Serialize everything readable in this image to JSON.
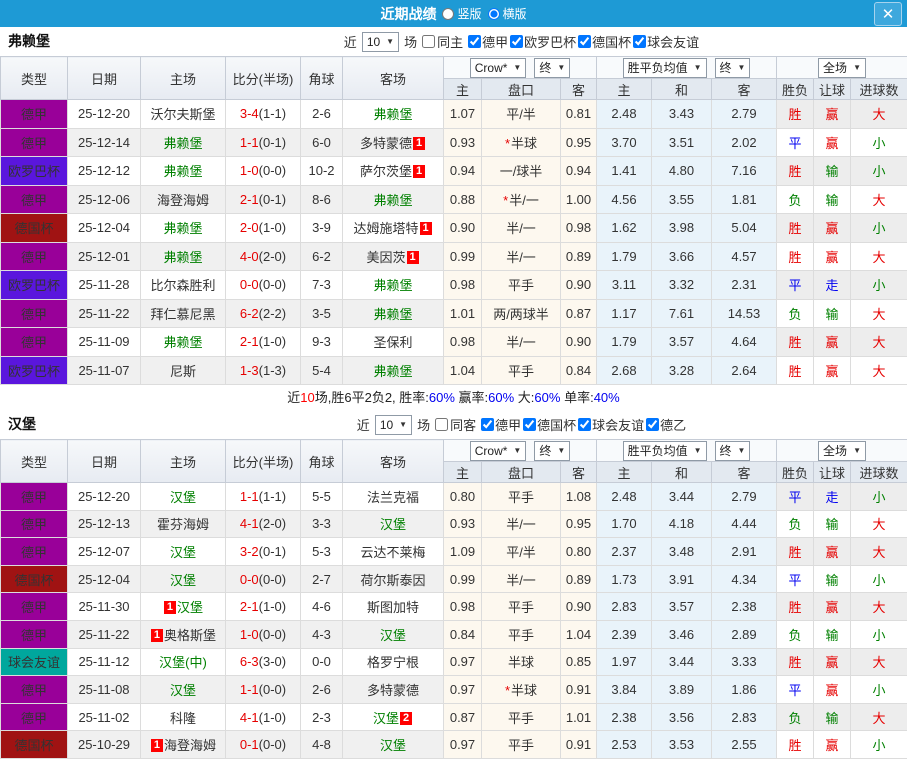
{
  "colors": {
    "titlebar_bg": "#1e9ad5",
    "league": {
      "德甲": "#990099",
      "欧罗巴杯": "#5a16dd",
      "德国杯": "#a01313",
      "球会友谊": "#00a79d"
    },
    "result": {
      "胜": "#e60000",
      "平": "#0000f0",
      "负": "#008000",
      "赢": "#e60000",
      "走": "#0000f0",
      "输": "#008000",
      "大": "#e60000",
      "小": "#008000"
    },
    "focus_team": "#008000",
    "score": "#e60000"
  },
  "titlebar": {
    "title": "近期战绩",
    "vertical_label": "竖版",
    "horizontal_label": "横版",
    "selected_layout": "横版",
    "close_icon": "✕"
  },
  "table_header": {
    "type": "类型",
    "date": "日期",
    "home": "主场",
    "score": "比分(半场)",
    "corners": "角球",
    "away": "客场",
    "crow_select": "Crow*",
    "final_select": "终",
    "avg_select": "胜平负均值",
    "scope_select": "全场",
    "sub": {
      "home": "主",
      "handicap": "盘口",
      "away": "客",
      "avg_home": "主",
      "avg_draw": "和",
      "avg_away": "客",
      "result": "胜负",
      "let": "让球",
      "goals": "进球数"
    }
  },
  "sections": [
    {
      "team": "弗赖堡",
      "filter": {
        "near": "近",
        "count": "10",
        "unit": "场",
        "same": "同主",
        "same_checked": false,
        "leagues": [
          "德甲",
          "欧罗巴杯",
          "德国杯",
          "球会友谊"
        ]
      },
      "rows": [
        {
          "type": "德甲",
          "date": "25-12-20",
          "home": {
            "name": "沃尔夫斯堡",
            "focus": false
          },
          "ft": "3-4",
          "ht": "(1-1)",
          "corners": "2-6",
          "away": {
            "name": "弗赖堡",
            "focus": true
          },
          "crow_home": "1.07",
          "handicap": "平/半",
          "handicap_star": false,
          "crow_away": "0.81",
          "avg_home": "2.48",
          "avg_draw": "3.43",
          "avg_away": "2.79",
          "result": "胜",
          "let_result": "赢",
          "goal_result": "大"
        },
        {
          "type": "德甲",
          "date": "25-12-14",
          "home": {
            "name": "弗赖堡",
            "focus": true
          },
          "ft": "1-1",
          "ht": "(0-1)",
          "corners": "6-0",
          "away": {
            "name": "多特蒙德",
            "focus": false,
            "badge": "1",
            "badge_pos": "after"
          },
          "crow_home": "0.93",
          "handicap": "半球",
          "handicap_star": true,
          "crow_away": "0.95",
          "avg_home": "3.70",
          "avg_draw": "3.51",
          "avg_away": "2.02",
          "result": "平",
          "let_result": "赢",
          "goal_result": "小"
        },
        {
          "type": "欧罗巴杯",
          "date": "25-12-12",
          "home": {
            "name": "弗赖堡",
            "focus": true
          },
          "ft": "1-0",
          "ht": "(0-0)",
          "corners": "10-2",
          "away": {
            "name": "萨尔茨堡",
            "focus": false,
            "badge": "1",
            "badge_pos": "after"
          },
          "crow_home": "0.94",
          "handicap": "一/球半",
          "handicap_star": false,
          "crow_away": "0.94",
          "avg_home": "1.41",
          "avg_draw": "4.80",
          "avg_away": "7.16",
          "result": "胜",
          "let_result": "输",
          "goal_result": "小"
        },
        {
          "type": "德甲",
          "date": "25-12-06",
          "home": {
            "name": "海登海姆",
            "focus": false
          },
          "ft": "2-1",
          "ht": "(0-1)",
          "corners": "8-6",
          "away": {
            "name": "弗赖堡",
            "focus": true
          },
          "crow_home": "0.88",
          "handicap": "半/一",
          "handicap_star": true,
          "crow_away": "1.00",
          "avg_home": "4.56",
          "avg_draw": "3.55",
          "avg_away": "1.81",
          "result": "负",
          "let_result": "输",
          "goal_result": "大"
        },
        {
          "type": "德国杯",
          "date": "25-12-04",
          "home": {
            "name": "弗赖堡",
            "focus": true
          },
          "ft": "2-0",
          "ht": "(1-0)",
          "corners": "3-9",
          "away": {
            "name": "达姆施塔特",
            "focus": false,
            "badge": "1",
            "badge_pos": "after"
          },
          "crow_home": "0.90",
          "handicap": "半/一",
          "handicap_star": false,
          "crow_away": "0.98",
          "avg_home": "1.62",
          "avg_draw": "3.98",
          "avg_away": "5.04",
          "result": "胜",
          "let_result": "赢",
          "goal_result": "小"
        },
        {
          "type": "德甲",
          "date": "25-12-01",
          "home": {
            "name": "弗赖堡",
            "focus": true
          },
          "ft": "4-0",
          "ht": "(2-0)",
          "corners": "6-2",
          "away": {
            "name": "美因茨",
            "focus": false,
            "badge": "1",
            "badge_pos": "after"
          },
          "crow_home": "0.99",
          "handicap": "半/一",
          "handicap_star": false,
          "crow_away": "0.89",
          "avg_home": "1.79",
          "avg_draw": "3.66",
          "avg_away": "4.57",
          "result": "胜",
          "let_result": "赢",
          "goal_result": "大"
        },
        {
          "type": "欧罗巴杯",
          "date": "25-11-28",
          "home": {
            "name": "比尔森胜利",
            "focus": false
          },
          "ft": "0-0",
          "ht": "(0-0)",
          "corners": "7-3",
          "away": {
            "name": "弗赖堡",
            "focus": true
          },
          "crow_home": "0.98",
          "handicap": "平手",
          "handicap_star": false,
          "crow_away": "0.90",
          "avg_home": "3.11",
          "avg_draw": "3.32",
          "avg_away": "2.31",
          "result": "平",
          "let_result": "走",
          "goal_result": "小"
        },
        {
          "type": "德甲",
          "date": "25-11-22",
          "home": {
            "name": "拜仁慕尼黑",
            "focus": false
          },
          "ft": "6-2",
          "ht": "(2-2)",
          "corners": "3-5",
          "away": {
            "name": "弗赖堡",
            "focus": true
          },
          "crow_home": "1.01",
          "handicap": "两/两球半",
          "handicap_star": false,
          "crow_away": "0.87",
          "avg_home": "1.17",
          "avg_draw": "7.61",
          "avg_away": "14.53",
          "result": "负",
          "let_result": "输",
          "goal_result": "大"
        },
        {
          "type": "德甲",
          "date": "25-11-09",
          "home": {
            "name": "弗赖堡",
            "focus": true
          },
          "ft": "2-1",
          "ht": "(1-0)",
          "corners": "9-3",
          "away": {
            "name": "圣保利",
            "focus": false
          },
          "crow_home": "0.98",
          "handicap": "半/一",
          "handicap_star": false,
          "crow_away": "0.90",
          "avg_home": "1.79",
          "avg_draw": "3.57",
          "avg_away": "4.64",
          "result": "胜",
          "let_result": "赢",
          "goal_result": "大"
        },
        {
          "type": "欧罗巴杯",
          "date": "25-11-07",
          "home": {
            "name": "尼斯",
            "focus": false
          },
          "ft": "1-3",
          "ht": "(1-3)",
          "corners": "5-4",
          "away": {
            "name": "弗赖堡",
            "focus": true
          },
          "crow_home": "1.04",
          "handicap": "平手",
          "handicap_star": false,
          "crow_away": "0.84",
          "avg_home": "2.68",
          "avg_draw": "3.28",
          "avg_away": "2.64",
          "result": "胜",
          "let_result": "赢",
          "goal_result": "大"
        }
      ],
      "summary": [
        {
          "t": "近",
          "c": "dark"
        },
        {
          "t": "10",
          "c": "red"
        },
        {
          "t": "场,胜6平2负2, 胜率:",
          "c": "dark"
        },
        {
          "t": "60%",
          "c": "blue"
        },
        {
          "t": " 赢率:",
          "c": "dark"
        },
        {
          "t": "60%",
          "c": "blue"
        },
        {
          "t": " 大:",
          "c": "dark"
        },
        {
          "t": "60%",
          "c": "blue"
        },
        {
          "t": " 单率:",
          "c": "dark"
        },
        {
          "t": "40%",
          "c": "blue"
        }
      ]
    },
    {
      "team": "汉堡",
      "filter": {
        "near": "近",
        "count": "10",
        "unit": "场",
        "same": "同客",
        "same_checked": false,
        "leagues": [
          "德甲",
          "德国杯",
          "球会友谊",
          "德乙"
        ]
      },
      "rows": [
        {
          "type": "德甲",
          "date": "25-12-20",
          "home": {
            "name": "汉堡",
            "focus": true
          },
          "ft": "1-1",
          "ht": "(1-1)",
          "corners": "5-5",
          "away": {
            "name": "法兰克福",
            "focus": false
          },
          "crow_home": "0.80",
          "handicap": "平手",
          "handicap_star": false,
          "crow_away": "1.08",
          "avg_home": "2.48",
          "avg_draw": "3.44",
          "avg_away": "2.79",
          "result": "平",
          "let_result": "走",
          "goal_result": "小"
        },
        {
          "type": "德甲",
          "date": "25-12-13",
          "home": {
            "name": "霍芬海姆",
            "focus": false
          },
          "ft": "4-1",
          "ht": "(2-0)",
          "corners": "3-3",
          "away": {
            "name": "汉堡",
            "focus": true
          },
          "crow_home": "0.93",
          "handicap": "半/一",
          "handicap_star": false,
          "crow_away": "0.95",
          "avg_home": "1.70",
          "avg_draw": "4.18",
          "avg_away": "4.44",
          "result": "负",
          "let_result": "输",
          "goal_result": "大"
        },
        {
          "type": "德甲",
          "date": "25-12-07",
          "home": {
            "name": "汉堡",
            "focus": true
          },
          "ft": "3-2",
          "ht": "(0-1)",
          "corners": "5-3",
          "away": {
            "name": "云达不莱梅",
            "focus": false
          },
          "crow_home": "1.09",
          "handicap": "平/半",
          "handicap_star": false,
          "crow_away": "0.80",
          "avg_home": "2.37",
          "avg_draw": "3.48",
          "avg_away": "2.91",
          "result": "胜",
          "let_result": "赢",
          "goal_result": "大"
        },
        {
          "type": "德国杯",
          "date": "25-12-04",
          "home": {
            "name": "汉堡",
            "focus": true
          },
          "ft": "0-0",
          "ht": "(0-0)",
          "corners": "2-7",
          "away": {
            "name": "荷尔斯泰因",
            "focus": false
          },
          "crow_home": "0.99",
          "handicap": "半/一",
          "handicap_star": false,
          "crow_away": "0.89",
          "avg_home": "1.73",
          "avg_draw": "3.91",
          "avg_away": "4.34",
          "result": "平",
          "let_result": "输",
          "goal_result": "小"
        },
        {
          "type": "德甲",
          "date": "25-11-30",
          "home": {
            "name": "汉堡",
            "focus": true,
            "badge": "1",
            "badge_pos": "before"
          },
          "ft": "2-1",
          "ht": "(1-0)",
          "corners": "4-6",
          "away": {
            "name": "斯图加特",
            "focus": false
          },
          "crow_home": "0.98",
          "handicap": "平手",
          "handicap_star": false,
          "crow_away": "0.90",
          "avg_home": "2.83",
          "avg_draw": "3.57",
          "avg_away": "2.38",
          "result": "胜",
          "let_result": "赢",
          "goal_result": "大"
        },
        {
          "type": "德甲",
          "date": "25-11-22",
          "home": {
            "name": "奥格斯堡",
            "focus": false,
            "badge": "1",
            "badge_pos": "before"
          },
          "ft": "1-0",
          "ht": "(0-0)",
          "corners": "4-3",
          "away": {
            "name": "汉堡",
            "focus": true
          },
          "crow_home": "0.84",
          "handicap": "平手",
          "handicap_star": false,
          "crow_away": "1.04",
          "avg_home": "2.39",
          "avg_draw": "3.46",
          "avg_away": "2.89",
          "result": "负",
          "let_result": "输",
          "goal_result": "小"
        },
        {
          "type": "球会友谊",
          "date": "25-11-12",
          "home": {
            "name": "汉堡(中)",
            "focus": true
          },
          "ft": "6-3",
          "ht": "(3-0)",
          "corners": "0-0",
          "away": {
            "name": "格罗宁根",
            "focus": false
          },
          "crow_home": "0.97",
          "handicap": "半球",
          "handicap_star": false,
          "crow_away": "0.85",
          "avg_home": "1.97",
          "avg_draw": "3.44",
          "avg_away": "3.33",
          "result": "胜",
          "let_result": "赢",
          "goal_result": "大"
        },
        {
          "type": "德甲",
          "date": "25-11-08",
          "home": {
            "name": "汉堡",
            "focus": true
          },
          "ft": "1-1",
          "ht": "(0-0)",
          "corners": "2-6",
          "away": {
            "name": "多特蒙德",
            "focus": false
          },
          "crow_home": "0.97",
          "handicap": "半球",
          "handicap_star": true,
          "crow_away": "0.91",
          "avg_home": "3.84",
          "avg_draw": "3.89",
          "avg_away": "1.86",
          "result": "平",
          "let_result": "赢",
          "goal_result": "小"
        },
        {
          "type": "德甲",
          "date": "25-11-02",
          "home": {
            "name": "科隆",
            "focus": false
          },
          "ft": "4-1",
          "ht": "(1-0)",
          "corners": "2-3",
          "away": {
            "name": "汉堡",
            "focus": true,
            "badge": "2",
            "badge_pos": "after"
          },
          "crow_home": "0.87",
          "handicap": "平手",
          "handicap_star": false,
          "crow_away": "1.01",
          "avg_home": "2.38",
          "avg_draw": "3.56",
          "avg_away": "2.83",
          "result": "负",
          "let_result": "输",
          "goal_result": "大"
        },
        {
          "type": "德国杯",
          "date": "25-10-29",
          "home": {
            "name": "海登海姆",
            "focus": false,
            "badge": "1",
            "badge_pos": "before"
          },
          "ft": "0-1",
          "ht": "(0-0)",
          "corners": "4-8",
          "away": {
            "name": "汉堡",
            "focus": true
          },
          "crow_home": "0.97",
          "handicap": "平手",
          "handicap_star": false,
          "crow_away": "0.91",
          "avg_home": "2.53",
          "avg_draw": "3.53",
          "avg_away": "2.55",
          "result": "胜",
          "let_result": "赢",
          "goal_result": "小"
        }
      ],
      "summary": null
    }
  ]
}
